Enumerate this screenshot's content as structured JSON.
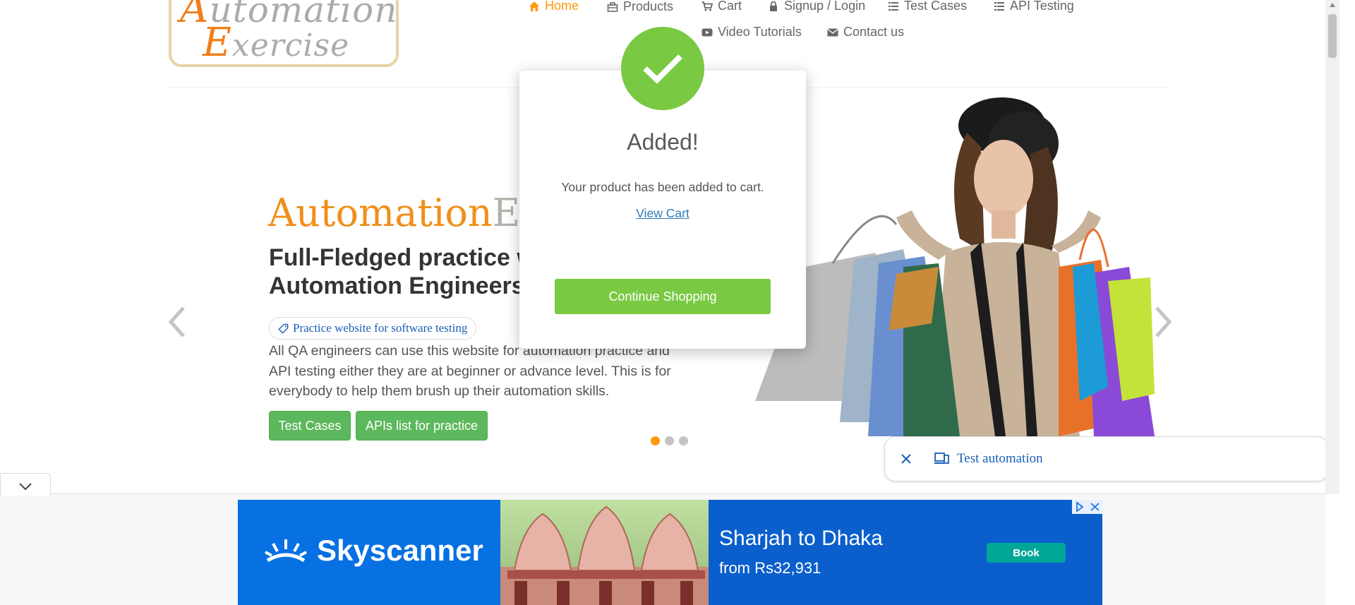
{
  "logo": {
    "line1_cap": "A",
    "line1_rest": "utomation",
    "line2_cap": "E",
    "line2_rest": "xercise"
  },
  "nav": {
    "items": [
      {
        "label": "Home",
        "icon": "home-icon",
        "active": true
      },
      {
        "label": "Products",
        "icon": "products-icon"
      },
      {
        "label": "Cart",
        "icon": "cart-icon"
      },
      {
        "label": "Signup / Login",
        "icon": "lock-icon"
      },
      {
        "label": "Test Cases",
        "icon": "list-icon"
      },
      {
        "label": "API Testing",
        "icon": "list-icon"
      },
      {
        "label": "Video Tutorials",
        "icon": "youtube-icon"
      },
      {
        "label": "Contact us",
        "icon": "envelope-icon"
      }
    ]
  },
  "hero": {
    "title_a": "Automation",
    "title_b": "Exercise",
    "subtitle": "Full-Fledged practice website for Automation Engineers",
    "tag": "Practice website for software testing",
    "description": "All QA engineers can use this website for automation practice and API testing either they are at beginner or advance level. This is for everybody to help them brush up their automation skills.",
    "btn_test_cases": "Test Cases",
    "btn_apis": "APIs list for practice",
    "slides_total": 3,
    "slide_active": 1
  },
  "modal": {
    "title": "Added!",
    "body": "Your product has been added to cart.",
    "link": "View Cart",
    "button": "Continue Shopping"
  },
  "chip": {
    "label": "Test automation"
  },
  "ad": {
    "brand": "Skyscanner",
    "headline": "Sharjah to Dhaka",
    "price": "from Rs32,931",
    "cta": "Book"
  },
  "colors": {
    "accent": "#fe980f",
    "success": "#7ac943",
    "green_btn": "#5cb85c",
    "ad_blue": "#0770e3"
  }
}
